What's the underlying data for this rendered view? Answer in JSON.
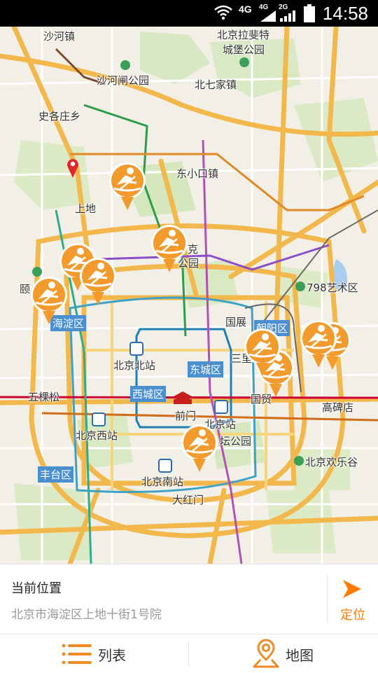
{
  "status_bar": {
    "time": "14:58",
    "network_1": "4G",
    "network_2": "4G",
    "network_3": "2G",
    "icons": [
      "wifi-icon",
      "signal-icon",
      "signal-icon",
      "battery-icon"
    ]
  },
  "map": {
    "places": {
      "shahezhen": "沙河镇",
      "beijing_lafeite": "北京拉斐特",
      "chengbao_park": "城堡公园",
      "shahezha_park": "沙河闸公园",
      "beiqijia": "北七家镇",
      "shigezhuang": "史各庄乡",
      "dongxiaokou": "东小口镇",
      "shangdi": "上地",
      "park_ke": "克",
      "park_gongyuan": "公园",
      "art_798": "798艺术区",
      "guozhan": "国展",
      "yihe": "颐",
      "beijing_north_station": "北京北站",
      "sanli": "三里",
      "wukesong": "五棵松",
      "qianmen": "前门",
      "guomao": "国贸",
      "gaobeidian": "高碑店",
      "beijing_station": "北京站",
      "beijing_west_station": "北京西站",
      "tan_park": "坛公园",
      "happy_valley": "北京欢乐谷",
      "beijing_south_station": "北京南站",
      "dahongmen": "大红门"
    },
    "districts": {
      "haidian": "海淀区",
      "chaoyang": "朝阳区",
      "dongcheng": "东城区",
      "xicheng": "西城区",
      "fengtai": "丰台区"
    },
    "marker_count": 10,
    "current_location_pin": "location-pin-icon",
    "marker_icon": "rowing-icon",
    "accent_color": "#f39a2c"
  },
  "location_panel": {
    "title": "当前位置",
    "address": "北京市海淀区上地十街1号院",
    "locate_label": "定位"
  },
  "tabs": {
    "list_label": "列表",
    "map_label": "地图",
    "list_icon": "list-icon",
    "map_icon": "map-pin-icon"
  }
}
